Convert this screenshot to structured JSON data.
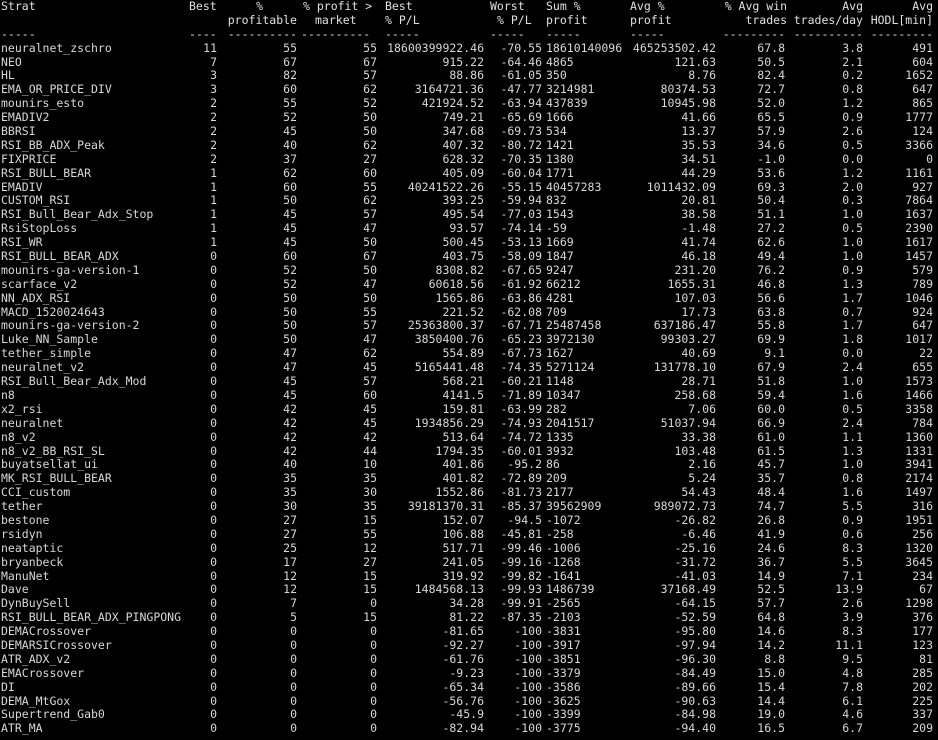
{
  "header": {
    "line1": [
      "Strat",
      "Best",
      "%",
      "% profit >",
      "Best",
      "Worst",
      "Sum %",
      "Avg %",
      "% Avg win",
      "Avg",
      "Avg"
    ],
    "line2": [
      "",
      "",
      "profitable",
      "market",
      "% P/L",
      "% P/L",
      "profit",
      "profit",
      "trades",
      "trades/day",
      "HODL[min]"
    ],
    "line3": [
      "-----",
      "----",
      "----------",
      "----------",
      "-----",
      "-----",
      "-----",
      "-----",
      "---------",
      "----------",
      "---------"
    ]
  },
  "rows": [
    [
      "neuralnet_zschro",
      "11",
      "55",
      "55",
      "18600399922.46",
      "-70.55",
      "18610140096",
      "465253502.42",
      "67.8",
      "3.8",
      "491"
    ],
    [
      "NEO",
      "7",
      "67",
      "67",
      "915.22",
      "-64.46",
      "4865",
      "121.63",
      "50.5",
      "2.1",
      "604"
    ],
    [
      "HL",
      "3",
      "82",
      "57",
      "88.86",
      "-61.05",
      "350",
      "8.76",
      "82.4",
      "0.2",
      "1652"
    ],
    [
      "EMA_OR_PRICE_DIV",
      "3",
      "60",
      "62",
      "3164721.36",
      "-47.77",
      "3214981",
      "80374.53",
      "72.7",
      "0.8",
      "647"
    ],
    [
      "mounirs_esto",
      "2",
      "55",
      "52",
      "421924.52",
      "-63.94",
      "437839",
      "10945.98",
      "52.0",
      "1.2",
      "865"
    ],
    [
      "EMADIV2",
      "2",
      "52",
      "50",
      "749.21",
      "-65.69",
      "1666",
      "41.66",
      "65.5",
      "0.9",
      "1777"
    ],
    [
      "BBRSI",
      "2",
      "45",
      "50",
      "347.68",
      "-69.73",
      "534",
      "13.37",
      "57.9",
      "2.6",
      "124"
    ],
    [
      "RSI_BB_ADX_Peak",
      "2",
      "40",
      "62",
      "407.32",
      "-80.72",
      "1421",
      "35.53",
      "34.6",
      "0.5",
      "3366"
    ],
    [
      "FIXPRICE",
      "2",
      "37",
      "27",
      "628.32",
      "-70.35",
      "1380",
      "34.51",
      "-1.0",
      "0.0",
      "0"
    ],
    [
      "RSI_BULL_BEAR",
      "1",
      "62",
      "60",
      "405.09",
      "-60.04",
      "1771",
      "44.29",
      "53.6",
      "1.2",
      "1161"
    ],
    [
      "EMADIV",
      "1",
      "60",
      "55",
      "40241522.26",
      "-55.15",
      "40457283",
      "1011432.09",
      "69.3",
      "2.0",
      "927"
    ],
    [
      "CUSTOM_RSI",
      "1",
      "50",
      "62",
      "393.25",
      "-59.94",
      "832",
      "20.81",
      "50.4",
      "0.3",
      "7864"
    ],
    [
      "RSI_Bull_Bear_Adx_Stop",
      "1",
      "45",
      "57",
      "495.54",
      "-77.03",
      "1543",
      "38.58",
      "51.1",
      "1.0",
      "1637"
    ],
    [
      "RsiStopLoss",
      "1",
      "45",
      "47",
      "93.57",
      "-74.14",
      "-59",
      "-1.48",
      "27.2",
      "0.5",
      "2390"
    ],
    [
      "RSI_WR",
      "1",
      "45",
      "50",
      "500.45",
      "-53.13",
      "1669",
      "41.74",
      "62.6",
      "1.0",
      "1617"
    ],
    [
      "RSI_BULL_BEAR_ADX",
      "0",
      "60",
      "67",
      "403.75",
      "-58.09",
      "1847",
      "46.18",
      "49.4",
      "1.0",
      "1457"
    ],
    [
      "mounirs-ga-version-1",
      "0",
      "52",
      "50",
      "8308.82",
      "-67.65",
      "9247",
      "231.20",
      "76.2",
      "0.9",
      "579"
    ],
    [
      "scarface_v2",
      "0",
      "52",
      "47",
      "60618.56",
      "-61.92",
      "66212",
      "1655.31",
      "46.8",
      "1.3",
      "789"
    ],
    [
      "NN_ADX_RSI",
      "0",
      "50",
      "50",
      "1565.86",
      "-63.86",
      "4281",
      "107.03",
      "56.6",
      "1.7",
      "1046"
    ],
    [
      "MACD_1520024643",
      "0",
      "50",
      "55",
      "221.52",
      "-62.08",
      "709",
      "17.73",
      "63.8",
      "0.7",
      "924"
    ],
    [
      "mounirs-ga-version-2",
      "0",
      "50",
      "57",
      "25363800.37",
      "-67.71",
      "25487458",
      "637186.47",
      "55.8",
      "1.7",
      "647"
    ],
    [
      "Luke_NN_Sample",
      "0",
      "50",
      "47",
      "3850400.76",
      "-65.23",
      "3972130",
      "99303.27",
      "69.9",
      "1.8",
      "1017"
    ],
    [
      "tether_simple",
      "0",
      "47",
      "62",
      "554.89",
      "-67.73",
      "1627",
      "40.69",
      "9.1",
      "0.0",
      "22"
    ],
    [
      "neuralnet_v2",
      "0",
      "47",
      "45",
      "5165441.48",
      "-74.35",
      "5271124",
      "131778.10",
      "67.9",
      "2.4",
      "655"
    ],
    [
      "RSI_Bull_Bear_Adx_Mod",
      "0",
      "45",
      "57",
      "568.21",
      "-60.21",
      "1148",
      "28.71",
      "51.8",
      "1.0",
      "1573"
    ],
    [
      "n8",
      "0",
      "45",
      "60",
      "4141.5",
      "-71.89",
      "10347",
      "258.68",
      "59.4",
      "1.6",
      "1466"
    ],
    [
      "x2_rsi",
      "0",
      "42",
      "45",
      "159.81",
      "-63.99",
      "282",
      "7.06",
      "60.0",
      "0.5",
      "3358"
    ],
    [
      "neuralnet",
      "0",
      "42",
      "45",
      "1934856.29",
      "-74.93",
      "2041517",
      "51037.94",
      "66.9",
      "2.4",
      "784"
    ],
    [
      "n8_v2",
      "0",
      "42",
      "42",
      "513.64",
      "-74.72",
      "1335",
      "33.38",
      "61.0",
      "1.1",
      "1360"
    ],
    [
      "n8_v2_BB_RSI_SL",
      "0",
      "42",
      "44",
      "1794.35",
      "-60.01",
      "3932",
      "103.48",
      "61.5",
      "1.3",
      "1331"
    ],
    [
      "buyatsellat_ui",
      "0",
      "40",
      "10",
      "401.86",
      "-95.2",
      "86",
      "2.16",
      "45.7",
      "1.0",
      "3941"
    ],
    [
      "MK_RSI_BULL_BEAR",
      "0",
      "35",
      "35",
      "401.82",
      "-72.89",
      "209",
      "5.24",
      "35.7",
      "0.8",
      "2174"
    ],
    [
      "CCI_custom",
      "0",
      "35",
      "30",
      "1552.86",
      "-81.73",
      "2177",
      "54.43",
      "48.4",
      "1.6",
      "1497"
    ],
    [
      "tether",
      "0",
      "30",
      "35",
      "39181370.31",
      "-85.37",
      "39562909",
      "989072.73",
      "74.7",
      "5.5",
      "316"
    ],
    [
      "bestone",
      "0",
      "27",
      "15",
      "152.07",
      "-94.5",
      "-1072",
      "-26.82",
      "26.8",
      "0.9",
      "1951"
    ],
    [
      "rsidyn",
      "0",
      "27",
      "55",
      "106.88",
      "-45.81",
      "-258",
      "-6.46",
      "41.9",
      "0.6",
      "256"
    ],
    [
      "neataptic",
      "0",
      "25",
      "12",
      "517.71",
      "-99.46",
      "-1006",
      "-25.16",
      "24.6",
      "8.3",
      "1320"
    ],
    [
      "bryanbeck",
      "0",
      "17",
      "27",
      "241.05",
      "-99.16",
      "-1268",
      "-31.72",
      "36.7",
      "5.5",
      "3645"
    ],
    [
      "ManuNet",
      "0",
      "12",
      "15",
      "319.92",
      "-99.82",
      "-1641",
      "-41.03",
      "14.9",
      "7.1",
      "234"
    ],
    [
      "Dave",
      "0",
      "12",
      "15",
      "1484568.13",
      "-99.93",
      "1486739",
      "37168.49",
      "52.5",
      "13.9",
      "67"
    ],
    [
      "DynBuySell",
      "0",
      "7",
      "0",
      "34.28",
      "-99.91",
      "-2565",
      "-64.15",
      "57.7",
      "2.6",
      "1298"
    ],
    [
      "RSI_BULL_BEAR_ADX_PINGPONG",
      "0",
      "5",
      "15",
      "81.22",
      "-87.35",
      "-2103",
      "-52.59",
      "64.8",
      "3.9",
      "376"
    ],
    [
      "DEMACrossover",
      "0",
      "0",
      "0",
      "-81.65",
      "-100",
      "-3831",
      "-95.80",
      "14.6",
      "8.3",
      "177"
    ],
    [
      "DEMARSICrossover",
      "0",
      "0",
      "0",
      "-92.27",
      "-100",
      "-3917",
      "-97.94",
      "14.2",
      "11.1",
      "123"
    ],
    [
      "ATR_ADX_v2",
      "0",
      "0",
      "0",
      "-61.76",
      "-100",
      "-3851",
      "-96.30",
      "8.8",
      "9.5",
      "81"
    ],
    [
      "EMACrossover",
      "0",
      "0",
      "0",
      "-9.23",
      "-100",
      "-3379",
      "-84.49",
      "15.0",
      "4.8",
      "285"
    ],
    [
      "DI",
      "0",
      "0",
      "0",
      "-65.34",
      "-100",
      "-3586",
      "-89.66",
      "15.4",
      "7.8",
      "202"
    ],
    [
      "DEMA_MtGox",
      "0",
      "0",
      "0",
      "-56.76",
      "-100",
      "-3625",
      "-90.63",
      "14.4",
      "6.1",
      "225"
    ],
    [
      "Supertrend_Gab0",
      "0",
      "0",
      "0",
      "-45.9",
      "-100",
      "-3399",
      "-84.98",
      "19.0",
      "4.6",
      "337"
    ],
    [
      "ATR_MA",
      "0",
      "0",
      "0",
      "-82.94",
      "-100",
      "-3775",
      "-94.40",
      "16.5",
      "6.7",
      "209"
    ]
  ]
}
